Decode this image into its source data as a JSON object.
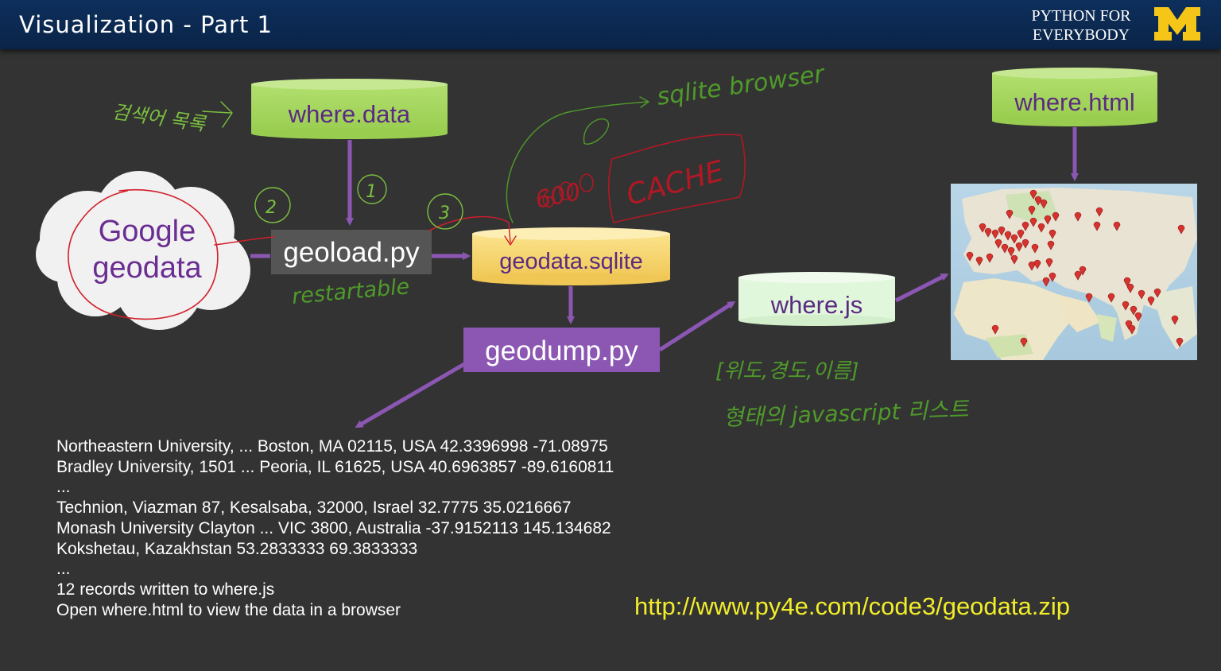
{
  "header": {
    "title": "Visualization - Part 1",
    "brand_line1": "PYTHON FOR",
    "brand_line2": "EVERYBODY",
    "logo_icon": "university-block-m-logo"
  },
  "nodes": {
    "where_data": "where.data",
    "google_geodata_line1": "Google",
    "google_geodata_line2": "geodata",
    "geoload": "geoload.py",
    "geodata_sqlite": "geodata.sqlite",
    "geodump": "geodump.py",
    "where_js": "where.js",
    "where_html": "where.html",
    "map_icon": "world-map-with-markers"
  },
  "output_lines": [
    "Northeastern University, ... Boston, MA 02115, USA 42.3396998 -71.08975",
    "Bradley University, 1501 ... Peoria, IL 61625, USA 40.6963857 -89.6160811",
    "...",
    "Technion, Viazman 87, Kesalsaba, 32000, Israel 32.7775 35.0216667",
    "Monash University Clayton ... VIC 3800, Australia -37.9152113 145.134682",
    "Kokshetau, Kazakhstan 53.2833333 69.3833333",
    "...",
    "12 records written to where.js",
    "Open where.html to view the data in a browser"
  ],
  "url": "http://www.py4e.com/code3/geodata.zip",
  "annotations": {
    "search_target": "검색어 목록",
    "sqlite_browser": "sqlite browser",
    "restartable": "restartable",
    "count": "600",
    "cache": "CACHE",
    "step1": "1",
    "step2": "2",
    "step3": "3",
    "js_list_line1": "[위도,경도,이름]",
    "js_list_line2": "형태의 javascript 리스트"
  },
  "colors": {
    "header": "#0b2a52",
    "background": "#333333",
    "green_cylinder": "#a3d65a",
    "yellow_cylinder": "#f7d66a",
    "light_cylinder": "#e1f7dc",
    "purple": "#8b57b3",
    "node_text": "#5a2a82",
    "url": "#f2ed2a",
    "logo": "#f5c518",
    "handwriting_green": "#7bbf3f",
    "handwriting_red": "#d21e2b"
  }
}
